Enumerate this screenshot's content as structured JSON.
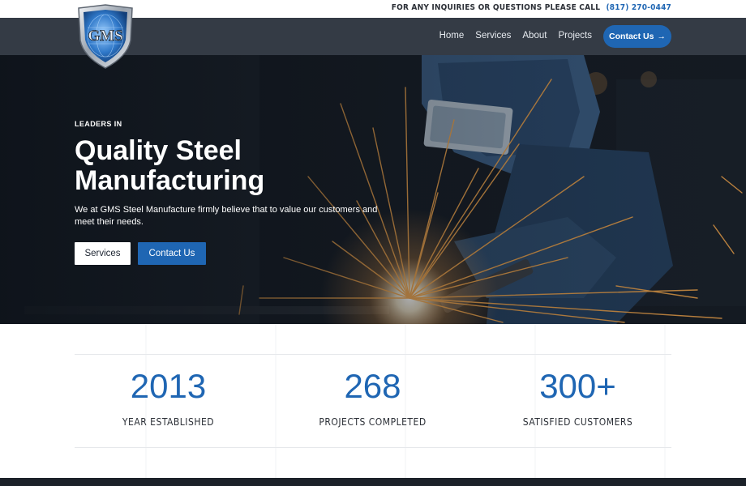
{
  "topbar": {
    "inquiry_text": "FOR ANY INQUIRIES OR QUESTIONS PLEASE CALL",
    "phone": "(817) 270-0447"
  },
  "logo": {
    "text": "GMS"
  },
  "nav": {
    "links": [
      "Home",
      "Services",
      "About",
      "Projects"
    ],
    "cta_label": "Contact Us",
    "cta_icon": "arrow-right-icon"
  },
  "hero": {
    "eyebrow": "LEADERS IN",
    "headline_line1": "Quality Steel",
    "headline_line2": "Manufacturing",
    "subtext_line1": "We at GMS Steel Manufacture firmly believe that to value our customers and",
    "subtext_line2": "meet their needs.",
    "button_services": "Services",
    "button_contact": "Contact Us"
  },
  "stats": [
    {
      "number": "2013",
      "label": "YEAR ESTABLISHED"
    },
    {
      "number": "268",
      "label": "PROJECTS COMPLETED"
    },
    {
      "number": "300+",
      "label": "SATISFIED CUSTOMERS"
    }
  ],
  "colors": {
    "accent_blue": "#1f66b3",
    "nav_bg": "#343b45",
    "hero_bg": "#11161d",
    "spark": "#f4a64a"
  }
}
